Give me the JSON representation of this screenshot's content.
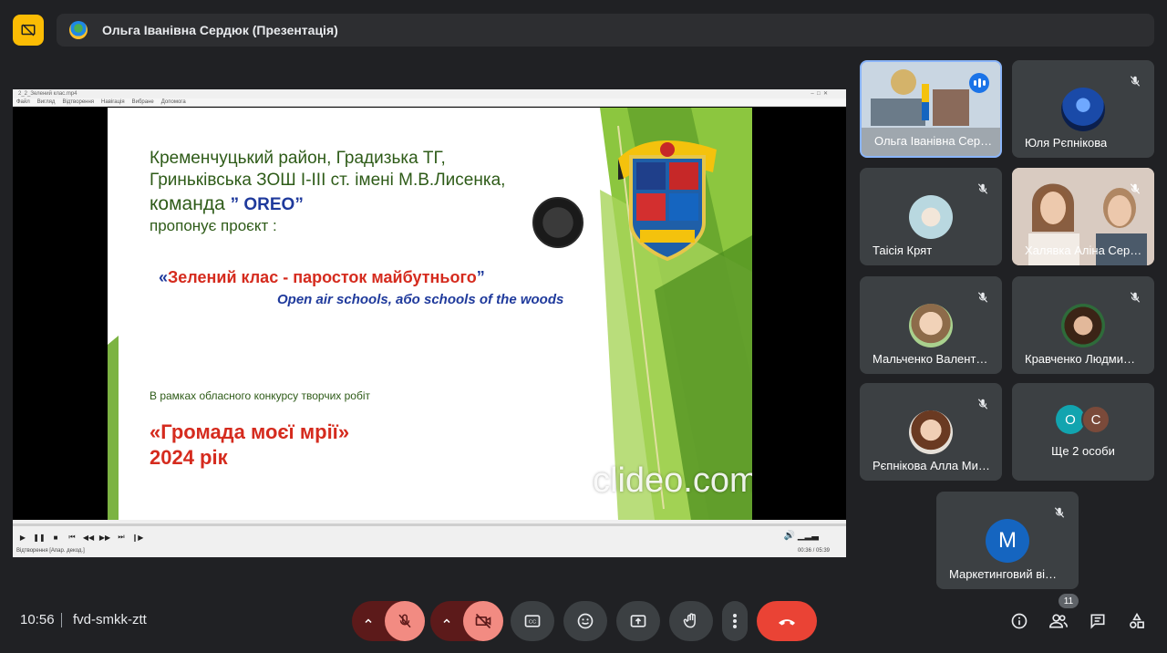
{
  "header": {
    "presenter_title": "Ольга Іванівна Сердюк (Презентація)",
    "present_icon": "stop-presenting-icon"
  },
  "player": {
    "window_title": "2_2_Зелений клас.mp4",
    "menu": [
      "Файл",
      "Вигляд",
      "Відтворення",
      "Навігація",
      "Вибране",
      "Допомога"
    ],
    "status": "Відтворення [Апар. декод.]",
    "time": "00:36 / 05:39"
  },
  "slide": {
    "line1": "Кременчуцький район, Градизька ТГ,",
    "line2": "Гриньківська ЗОШ І-ІІІ ст. імені М.В.Лисенка,",
    "team_prefix": "команда ",
    "team_name": "” OREO”",
    "offer": "пропонує проєкт :",
    "project_open": "«",
    "project_title": "Зелений клас - паросток майбутнього",
    "project_close": "”",
    "subtitle": "Open air schools, або schools of the woods",
    "frame": "В рамках обласного  конкурсу творчих робіт",
    "contest_line1": "«Громада моєї мрії»",
    "contest_line2": "2024 рік",
    "watermark": "clideo.com"
  },
  "participants": [
    {
      "name": "Ольга Іванівна Сер…",
      "speaking": true
    },
    {
      "name": "Юля Рєпнікова",
      "muted": true
    },
    {
      "name": "Таісія Крят",
      "muted": true
    },
    {
      "name": "Халявка Аліна Сер…",
      "muted": true
    },
    {
      "name": "Мальченко Валент…",
      "muted": true
    },
    {
      "name": "Кравченко Людми…",
      "muted": true
    },
    {
      "name": "Рєпнікова Алла Ми…",
      "muted": true
    },
    {
      "name": "Ще 2 особи",
      "avatars": [
        "O",
        "C"
      ]
    },
    {
      "name": "Маркетинговий ві…",
      "muted": true,
      "initial": "M"
    }
  ],
  "footer": {
    "time": "10:56",
    "separator": "|",
    "meeting_code": "fvd-smkk-ztt",
    "people_count": "11"
  },
  "colors": {
    "background": "#202124",
    "tile": "#3c4043",
    "danger": "#ea4335",
    "muted_bg": "#f28b82",
    "accent": "#fbbc04",
    "speaking": "#1a73e8"
  }
}
